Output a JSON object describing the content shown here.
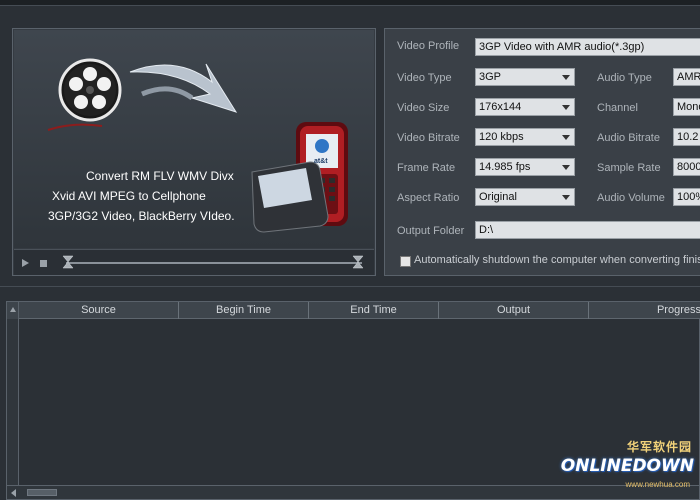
{
  "preview": {
    "promo_lines": [
      "Convert RM FLV WMV Divx",
      "Xvid AVI MPEG to Cellphone",
      "3GP/3G2 Video, BlackBerry VIdeo."
    ],
    "phone_brand": "at&t"
  },
  "settings": {
    "video_profile_label": "Video Profile",
    "video_profile_value": "3GP Video with AMR audio(*.3gp)",
    "video_type_label": "Video Type",
    "video_type_value": "3GP",
    "video_size_label": "Video Size",
    "video_size_value": "176x144",
    "video_bitrate_label": "Video Bitrate",
    "video_bitrate_value": "120 kbps",
    "frame_rate_label": "Frame Rate",
    "frame_rate_value": "14.985 fps",
    "aspect_ratio_label": "Aspect Ratio",
    "aspect_ratio_value": "Original",
    "audio_type_label": "Audio Type",
    "audio_type_value": "AMR",
    "channel_label": "Channel",
    "channel_value": "Mono",
    "audio_bitrate_label": "Audio Bitrate",
    "audio_bitrate_value": "10.2",
    "sample_rate_label": "Sample Rate",
    "sample_rate_value": "8000",
    "audio_volume_label": "Audio Volume",
    "audio_volume_value": "100%",
    "output_folder_label": "Output Folder",
    "output_folder_value": "D:\\",
    "shutdown_label": "Automatically shutdown the computer when converting finis"
  },
  "table": {
    "columns": [
      "Source",
      "Begin Time",
      "End Time",
      "Output",
      "Progress"
    ]
  },
  "watermark": {
    "top": "华军软件园",
    "main": "ONLINEDOWN",
    "sub": "www.newhua.com"
  },
  "colors": {
    "background": "#2b3036",
    "panel": "#3a4047",
    "field": "#dfe2e5",
    "accent": "#b01e23"
  }
}
